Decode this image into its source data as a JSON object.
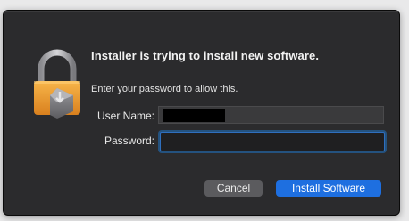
{
  "dialog": {
    "title": "Installer is trying to install new software.",
    "subtitle": "Enter your password to allow this.",
    "fields": {
      "user_name_label": "User Name:",
      "user_name_value": "",
      "password_label": "Password:",
      "password_value": ""
    },
    "buttons": {
      "cancel_label": "Cancel",
      "install_label": "Install Software"
    },
    "icon": "padlock-with-installer-icon"
  },
  "colors": {
    "dialog_bg": "#2b2b2d",
    "accent_blue": "#1e6fe0",
    "cancel_gray": "#5b5b5e",
    "lock_orange": "#f2a23a"
  }
}
